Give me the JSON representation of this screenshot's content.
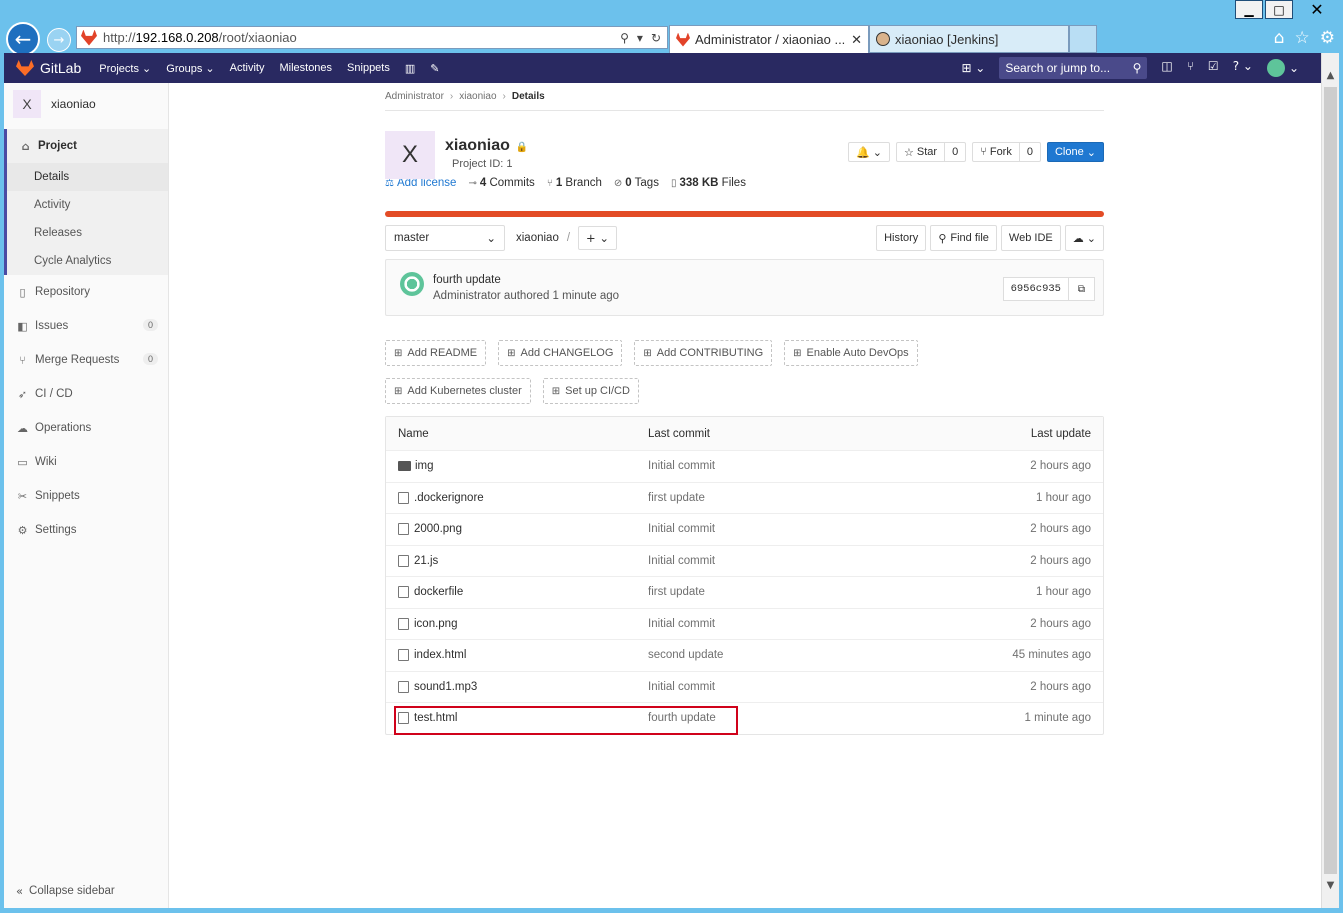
{
  "window": {
    "min": "▁",
    "max": "□",
    "close": "✕"
  },
  "browser": {
    "url_prefix": "http://",
    "url_host": "192.168.0.208",
    "url_path": "/root/xiaoniao",
    "tab_active": "Administrator / xiaoniao ...",
    "tab_other": "xiaoniao [Jenkins]"
  },
  "header": {
    "logo": "GitLab",
    "nav": [
      "Projects ⌄",
      "Groups ⌄",
      "Activity",
      "Milestones",
      "Snippets"
    ],
    "search_placeholder": "Search or jump to..."
  },
  "sidebar": {
    "project_initial": "X",
    "project_name": "xiaoniao",
    "project_label": "Project",
    "sub_items": [
      "Details",
      "Activity",
      "Releases",
      "Cycle Analytics"
    ],
    "items": [
      {
        "label": "Repository",
        "icon": "repository-icon"
      },
      {
        "label": "Issues",
        "icon": "issues-icon",
        "badge": "0"
      },
      {
        "label": "Merge Requests",
        "icon": "merge-request-icon",
        "badge": "0"
      },
      {
        "label": "CI / CD",
        "icon": "rocket-icon"
      },
      {
        "label": "Operations",
        "icon": "cloud-gear-icon"
      },
      {
        "label": "Wiki",
        "icon": "book-icon"
      },
      {
        "label": "Snippets",
        "icon": "scissors-icon"
      },
      {
        "label": "Settings",
        "icon": "gear-icon"
      }
    ],
    "collapse": "Collapse sidebar"
  },
  "breadcrumb": [
    "Administrator",
    "xiaoniao",
    "Details"
  ],
  "project": {
    "initial": "X",
    "title": "xiaoniao",
    "id": "Project ID: 1",
    "star": "Star",
    "star_count": "0",
    "fork": "Fork",
    "fork_count": "0",
    "clone": "Clone"
  },
  "stats": {
    "add_license": "Add license",
    "commits_n": "4",
    "commits": "Commits",
    "branch_n": "1",
    "branch": "Branch",
    "tags_n": "0",
    "tags": "Tags",
    "size_n": "338 KB",
    "size": "Files"
  },
  "toolbar": {
    "branch": "master",
    "path": "xiaoniao",
    "history": "History",
    "find_file": "Find file",
    "web_ide": "Web IDE"
  },
  "commit": {
    "title": "fourth update",
    "author_line": "Administrator authored 1 minute ago",
    "sha": "6956c935"
  },
  "add_buttons": [
    "Add README",
    "Add CHANGELOG",
    "Add CONTRIBUTING",
    "Enable Auto DevOps",
    "Add Kubernetes cluster",
    "Set up CI/CD"
  ],
  "files_header": {
    "name": "Name",
    "last_commit": "Last commit",
    "last_update": "Last update"
  },
  "files": [
    {
      "name": "img",
      "type": "folder",
      "commit": "Initial commit",
      "updated": "2 hours ago"
    },
    {
      "name": ".dockerignore",
      "type": "file",
      "commit": "first update",
      "updated": "1 hour ago"
    },
    {
      "name": "2000.png",
      "type": "image",
      "commit": "Initial commit",
      "updated": "2 hours ago"
    },
    {
      "name": "21.js",
      "type": "file",
      "commit": "Initial commit",
      "updated": "2 hours ago"
    },
    {
      "name": "dockerfile",
      "type": "file",
      "commit": "first update",
      "updated": "1 hour ago"
    },
    {
      "name": "icon.png",
      "type": "image",
      "commit": "Initial commit",
      "updated": "2 hours ago"
    },
    {
      "name": "index.html",
      "type": "file",
      "commit": "second update",
      "updated": "45 minutes ago"
    },
    {
      "name": "sound1.mp3",
      "type": "audio",
      "commit": "Initial commit",
      "updated": "2 hours ago"
    },
    {
      "name": "test.html",
      "type": "file",
      "commit": "fourth update",
      "updated": "1 minute ago"
    }
  ],
  "highlight_color": "#d0021b",
  "brand_color": "#292961",
  "accent_color": "#1f78d1"
}
